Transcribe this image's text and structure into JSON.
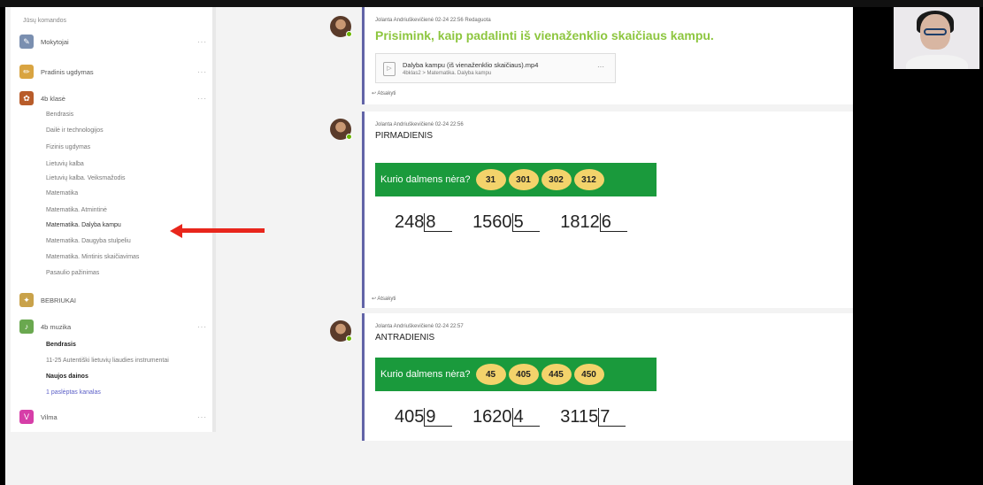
{
  "sidebar": {
    "heading": "Jūsų komandos",
    "teams": [
      {
        "name": "Mokytojai",
        "icon": "teacher-icon",
        "color": "#7a8fb0"
      },
      {
        "name": "Pradinis ugdymas",
        "icon": "pencil-icon",
        "color": "#d9a441"
      },
      {
        "name": "4b klasė",
        "icon": "class-icon",
        "color": "#b85c2a"
      }
    ],
    "channels_4b": [
      "Bendrasis",
      "Dailė ir technologijos",
      "Fizinis ugdymas",
      "Lietuvių kalba",
      "Lietuvių kalba. Veiksmažodis",
      "Matematika",
      "Matematika. Atmintinė",
      "Matematika. Dalyba kampu",
      "Matematika. Daugyba stulpeliu",
      "Matematika. Mintinis skaičiavimas",
      "Pasaulio pažinimas"
    ],
    "team_bebriukai": "BEBRIUKAI",
    "team_muzika": "4b muzika",
    "channels_muzika": [
      "Bendrasis",
      "11-25 Autentiški lietuvių liaudies instrumentai",
      "Naujos dainos",
      "1 paslėptas kanalas"
    ],
    "team_vilma": "Vilma",
    "more": "···"
  },
  "posts": [
    {
      "meta": "Jolanta Andriuškevičienė   02-24 22:56   Redaguota",
      "title": "Prisimink, kaip padalinti iš vienaženklio skaičiaus kampu.",
      "attachment_name": "Dalyba kampu (iš vienaženklio skaičiaus).mp4",
      "attachment_path": "4bklas2 > Matematika. Dalyba kampu",
      "reply": "Atsakyti"
    },
    {
      "meta": "Jolanta Andriuškevičienė   02-24 22:56",
      "title": "PIRMADIENIS",
      "question": "Kurio dalmens nėra?",
      "options": [
        "31",
        "301",
        "302",
        "312"
      ],
      "divisions": [
        {
          "dividend": "248",
          "divisor": "8"
        },
        {
          "dividend": "1560",
          "divisor": "5"
        },
        {
          "dividend": "1812",
          "divisor": "6"
        }
      ],
      "reply": "Atsakyti"
    },
    {
      "meta": "Jolanta Andriuškevičienė   02-24 22:57",
      "title": "ANTRADIENIS",
      "question": "Kurio dalmens nėra?",
      "options": [
        "45",
        "405",
        "445",
        "450"
      ],
      "divisions": [
        {
          "dividend": "405",
          "divisor": "9"
        },
        {
          "dividend": "1620",
          "divisor": "4"
        },
        {
          "dividend": "3115",
          "divisor": "7"
        }
      ]
    }
  ],
  "colors": {
    "accent": "#6264a7",
    "green_title": "#8dc63f",
    "banner": "#1a9a3c",
    "option": "#f3d36b",
    "arrow": "#e8261c"
  }
}
